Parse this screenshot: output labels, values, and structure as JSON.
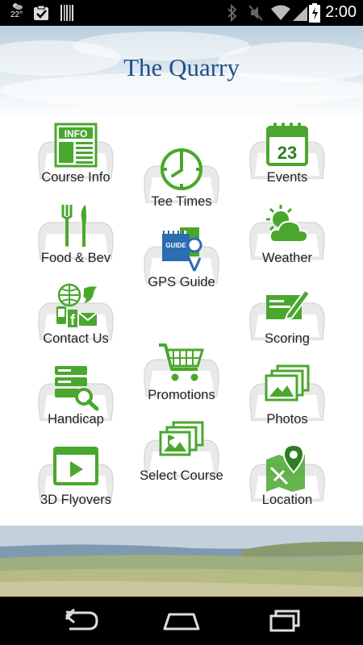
{
  "status_bar": {
    "temperature": "22°",
    "time": "2:00"
  },
  "app": {
    "title": "The Quarry"
  },
  "colors": {
    "icon_green": "#4aa72e",
    "title_blue": "#1f4f8a",
    "icon_blue": "#2a6db0"
  },
  "menu": {
    "course_info": {
      "label": "Course Info",
      "icon_text": "INFO"
    },
    "tee_times": {
      "label": "Tee Times"
    },
    "events": {
      "label": "Events",
      "icon_text": "23"
    },
    "food_bev": {
      "label": "Food & Bev"
    },
    "gps_guide": {
      "label": "GPS Guide",
      "icon_text": "GUIDE"
    },
    "weather": {
      "label": "Weather"
    },
    "contact_us": {
      "label": "Contact Us"
    },
    "scoring": {
      "label": "Scoring"
    },
    "promotions": {
      "label": "Promotions"
    },
    "handicap": {
      "label": "Handicap"
    },
    "photos": {
      "label": "Photos"
    },
    "select_course": {
      "label": "Select Course"
    },
    "flyovers": {
      "label": "3D Flyovers"
    },
    "location": {
      "label": "Location"
    }
  }
}
